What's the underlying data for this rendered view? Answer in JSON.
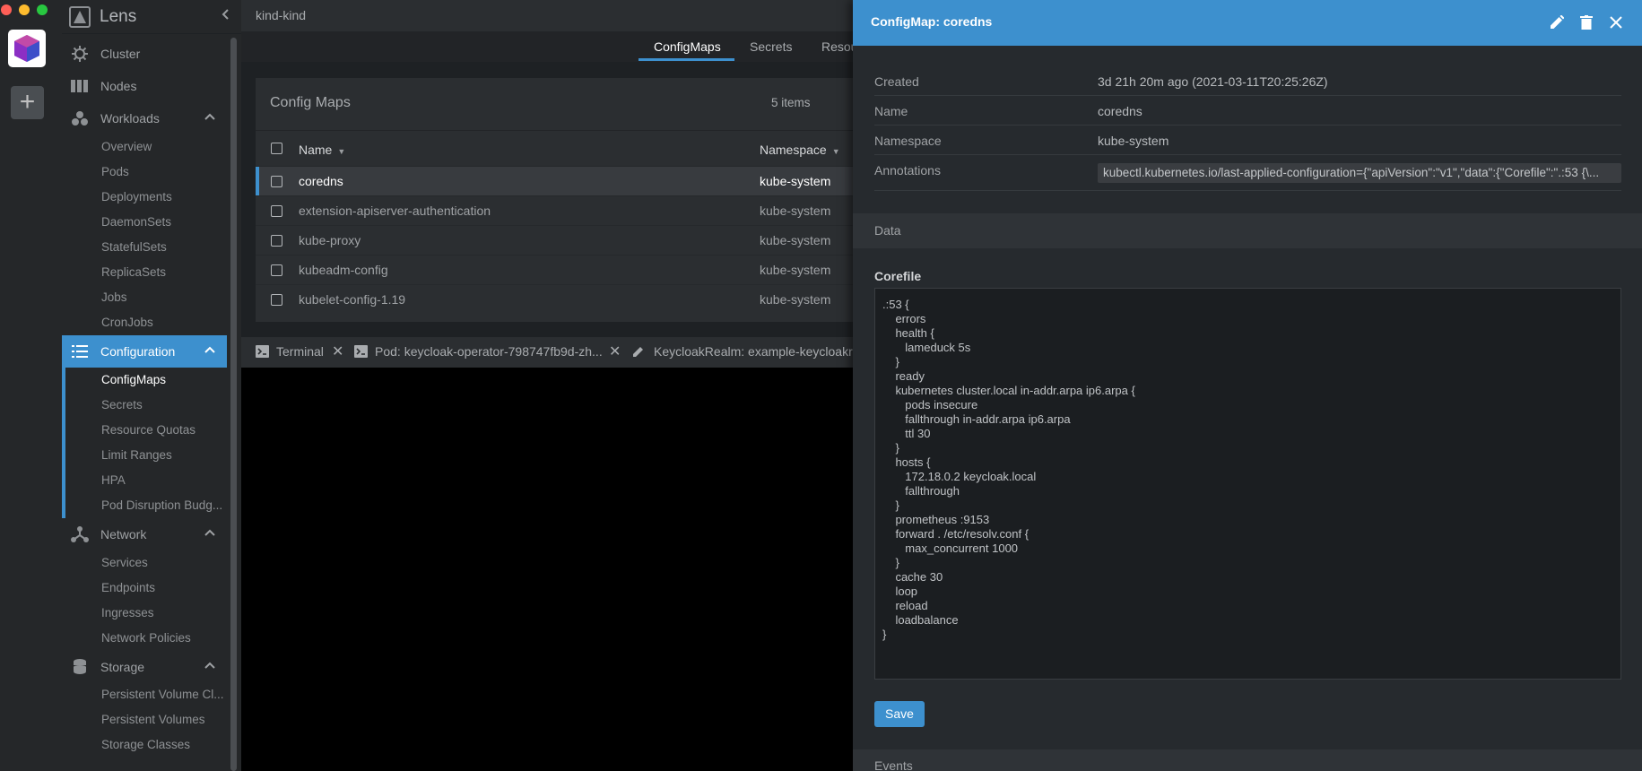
{
  "app": {
    "title": "Lens",
    "cluster_name": "kind-kind"
  },
  "colors": {
    "accent": "#3d90ce",
    "sidebar_bg": "#252729",
    "main_bg": "#1e2124"
  },
  "sidebar": {
    "cluster": "Cluster",
    "nodes": "Nodes",
    "workloads": {
      "label": "Workloads",
      "items": [
        "Overview",
        "Pods",
        "Deployments",
        "DaemonSets",
        "StatefulSets",
        "ReplicaSets",
        "Jobs",
        "CronJobs"
      ]
    },
    "configuration": {
      "label": "Configuration",
      "items": [
        "ConfigMaps",
        "Secrets",
        "Resource Quotas",
        "Limit Ranges",
        "HPA",
        "Pod Disruption Budg..."
      ]
    },
    "network": {
      "label": "Network",
      "items": [
        "Services",
        "Endpoints",
        "Ingresses",
        "Network Policies"
      ]
    },
    "storage": {
      "label": "Storage",
      "items": [
        "Persistent Volume Cl...",
        "Persistent Volumes",
        "Storage Classes"
      ]
    }
  },
  "tabs": [
    "ConfigMaps",
    "Secrets",
    "Resou"
  ],
  "config_maps": {
    "title": "Config Maps",
    "count": "5 items",
    "columns": {
      "name": "Name",
      "namespace": "Namespace"
    },
    "rows": [
      {
        "name": "coredns",
        "namespace": "kube-system"
      },
      {
        "name": "extension-apiserver-authentication",
        "namespace": "kube-system"
      },
      {
        "name": "kube-proxy",
        "namespace": "kube-system"
      },
      {
        "name": "kubeadm-config",
        "namespace": "kube-system"
      },
      {
        "name": "kubelet-config-1.19",
        "namespace": "kube-system"
      }
    ]
  },
  "dock": {
    "tabs": [
      "Terminal",
      "Pod: keycloak-operator-798747fb9d-zh...",
      "KeycloakRealm: example-keycloakre"
    ]
  },
  "drawer": {
    "title": "ConfigMap: coredns",
    "meta": {
      "created_label": "Created",
      "created_value": "3d 21h 20m ago (2021-03-11T20:25:26Z)",
      "name_label": "Name",
      "name_value": "coredns",
      "namespace_label": "Namespace",
      "namespace_value": "kube-system",
      "annotations_label": "Annotations",
      "annotations_value": "kubectl.kubernetes.io/last-applied-configuration={\"apiVersion\":\"v1\",\"data\":{\"Corefile\":\".:53 {\\..."
    },
    "data_label": "Data",
    "corefile_label": "Corefile",
    "corefile_content": ".:53 {\n    errors\n    health {\n       lameduck 5s\n    }\n    ready\n    kubernetes cluster.local in-addr.arpa ip6.arpa {\n       pods insecure\n       fallthrough in-addr.arpa ip6.arpa\n       ttl 30\n    }\n    hosts {\n       172.18.0.2 keycloak.local\n       fallthrough\n    }\n    prometheus :9153\n    forward . /etc/resolv.conf {\n       max_concurrent 1000\n    }\n    cache 30\n    loop\n    reload\n    loadbalance\n}",
    "save_label": "Save",
    "events_label": "Events"
  }
}
